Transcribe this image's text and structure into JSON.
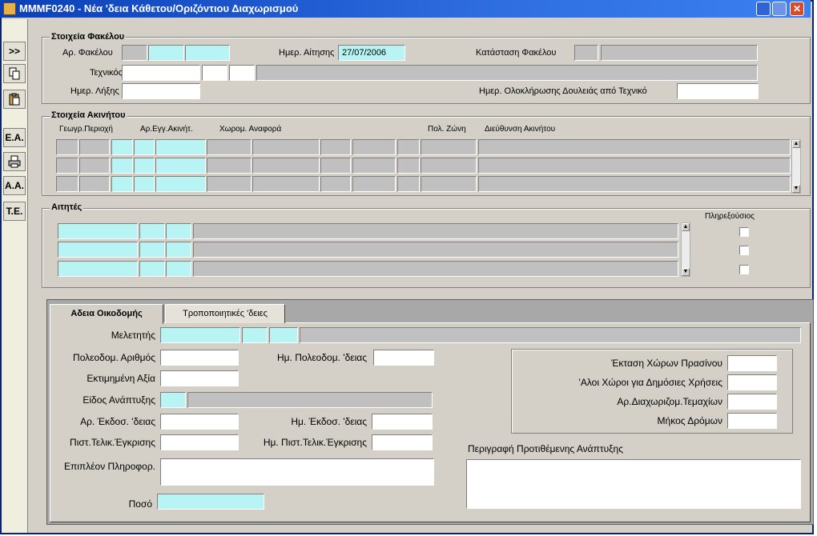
{
  "window": {
    "title": "MMMF0240 - Νέα 'δεια Κάθετου/Οριζόντιου Διαχωρισμού",
    "close_glyph": "✕"
  },
  "sidebar": {
    "buttons": [
      ">>",
      "copy-icon",
      "paste-icon",
      "Ε.Α.",
      "print-icon",
      "Α.Α.",
      "Τ.Ε."
    ],
    "labels": {
      "expand": ">>",
      "ea": "Ε.Α.",
      "aa": "Α.Α.",
      "te": "Τ.Ε."
    }
  },
  "folder": {
    "legend": "Στοιχεία Φακέλου",
    "folder_no_label": "Αρ. Φακέλου",
    "application_date_label": "Ημερ. Αίτησης",
    "application_date_value": "27/07/2006",
    "folder_status_label": "Κατάσταση Φακέλου",
    "technician_label": "Τεχνικός",
    "receipt_date_label": "Ημερ. Λήξης",
    "completion_date_label": "Ημερ. Ολοκλήρωσης Δουλειάς από Τεχνικό"
  },
  "property": {
    "legend": "Στοιχεία Ακινήτου",
    "columns": {
      "geo_area": "Γεωγρ.Περιοχή",
      "reg_no": "Αρ.Εγγ.Ακινήτ.",
      "map_ref": "Χωρομ. Αναφορά",
      "zone": "Πολ. Ζώνη",
      "address": "Διεύθυνση Ακινήτου"
    }
  },
  "claims": {
    "legend": "Αιτητές",
    "full_owner_label": "Πληρεξούσιος"
  },
  "tabs": {
    "building": "Αδεια Οικοδομής",
    "amendment": "Τροποποιητικές 'δειες"
  },
  "building": {
    "engineer_label": "Μελετητής",
    "urban_no_label": "Πολεοδομ. Αριθμός",
    "urban_date_label": "Ημ. Πολεοδομ. 'δειας",
    "estimated_value_label": "Εκτιμημένη Αξία",
    "development_type_label": "Είδος Ανάπτυξης",
    "permit_no_label": "Αρ. Έκδοσ. 'δειας",
    "permit_date_label": "Ημ. Έκδοσ. 'δειας",
    "cert_label": "Πιστ.Τελικ.Έγκρισης",
    "cert_date_label": "Ημ. Πιστ.Τελικ.Έγκρισης",
    "extra_info_label": "Επιπλέον Πληροφορ.",
    "amount_label": "Ποσό",
    "green_area_label": "Έκταση Χώρων Πρασίνου",
    "public_area_label": "'Αλοι Χώροι για Δημόσιες Χρήσεις",
    "parcels_label": "Αρ.Διαχωριζομ.Τεμαχίων",
    "road_length_label": "Μήκος Δρόμων",
    "description_label": "Περιγραφή Προτιθέμενης Ανάπτυξης"
  }
}
